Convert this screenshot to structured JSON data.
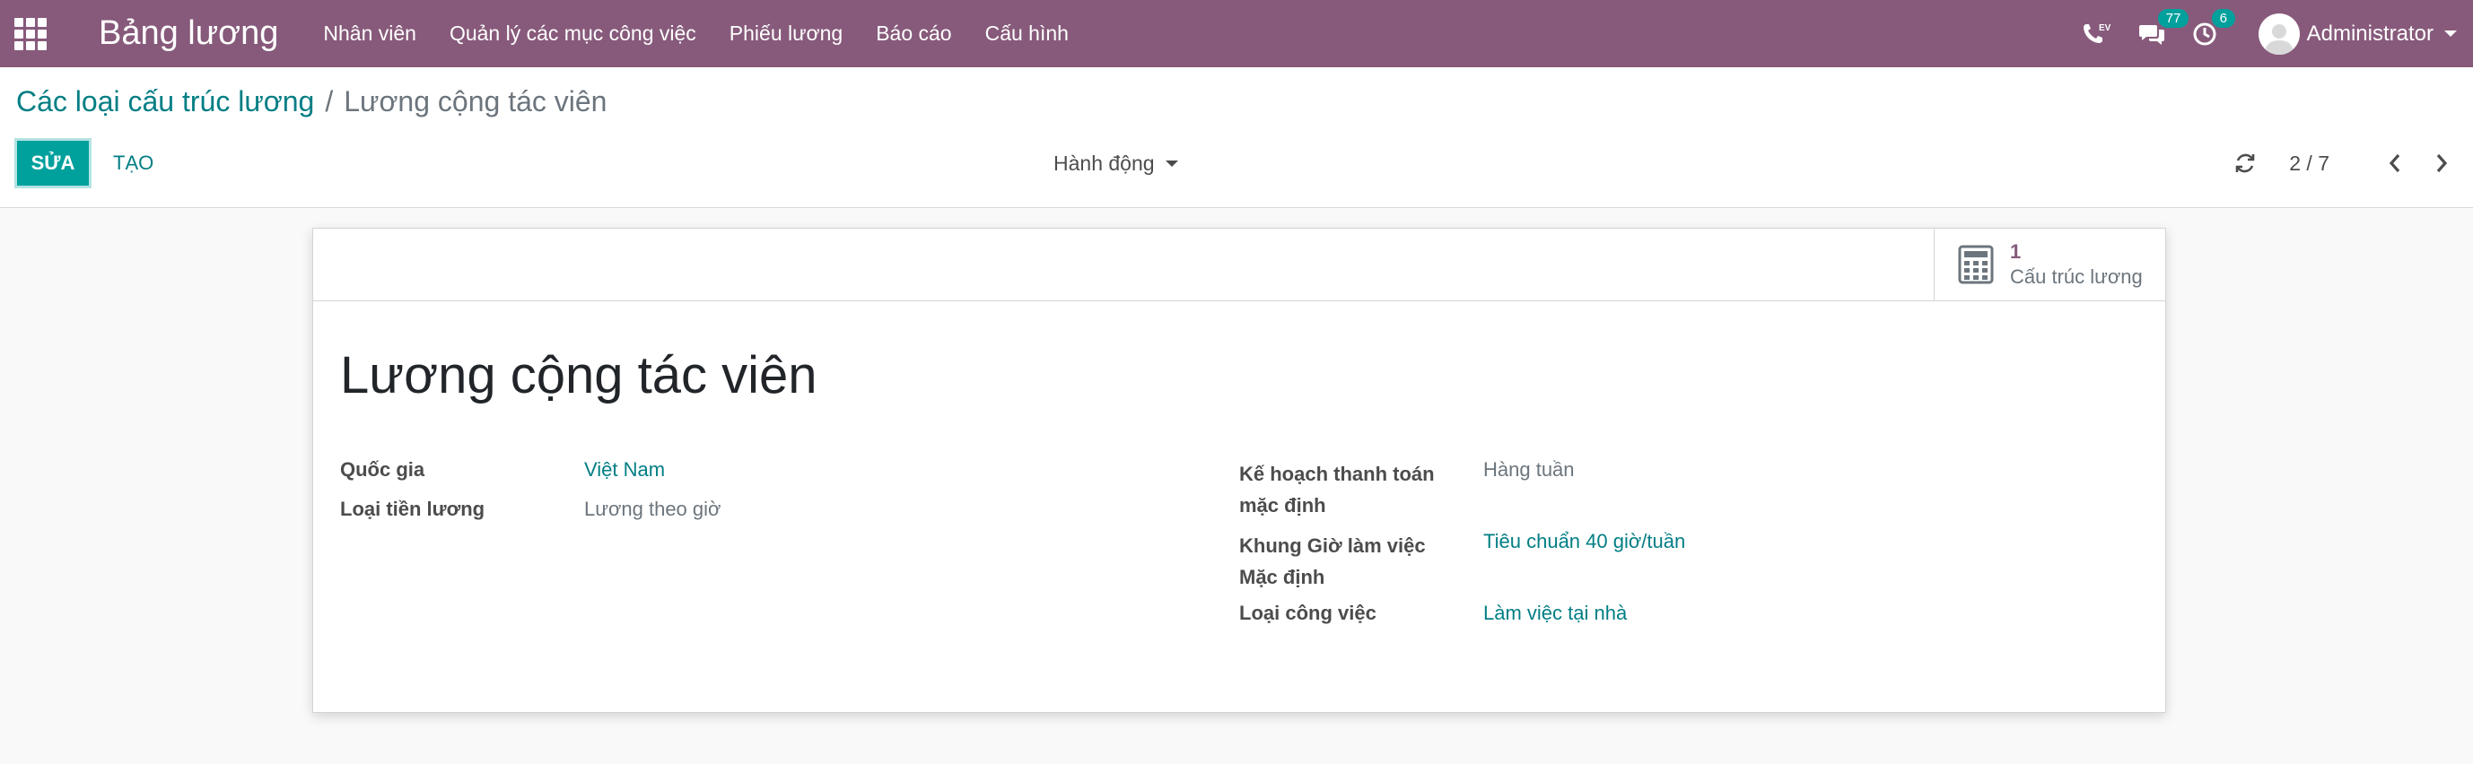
{
  "navbar": {
    "app_title": "Bảng lương",
    "menu": [
      "Nhân viên",
      "Quản lý các mục công việc",
      "Phiếu lương",
      "Báo cáo",
      "Cấu hình"
    ],
    "phone_badge": "EV",
    "messages_count": "77",
    "activities_count": "6",
    "user_name": "Administrator"
  },
  "breadcrumb": {
    "parent": "Các loại cấu trúc lương",
    "separator": "/",
    "current": "Lương cộng tác viên"
  },
  "control": {
    "edit_label": "SỬA",
    "create_label": "TẠO",
    "action_label": "Hành động",
    "pager_value": "2 / 7"
  },
  "form": {
    "stat_button": {
      "value": "1",
      "label": "Cấu trúc lương",
      "icon": "calculator-icon"
    },
    "title": "Lương cộng tác viên",
    "left_fields": [
      {
        "label": "Quốc gia",
        "value": "Việt Nam",
        "link": true
      },
      {
        "label": "Loại tiền lương",
        "value": "Lương theo giờ",
        "link": false
      }
    ],
    "right_fields": [
      {
        "label_line1": "Kế hoạch thanh toán",
        "label_line2": "mặc định",
        "value": "Hàng tuần",
        "link": false
      },
      {
        "label_line1": "Khung Giờ làm việc",
        "label_line2": "Mặc định",
        "value": "Tiêu chuẩn 40 giờ/tuần",
        "link": true
      },
      {
        "label_line1": "Loại công việc",
        "label_line2": "",
        "value": "Làm việc tại nhà",
        "link": true
      }
    ]
  },
  "colors": {
    "navbar": "#875a7b",
    "primary": "#00a09d",
    "link": "#017e84"
  }
}
